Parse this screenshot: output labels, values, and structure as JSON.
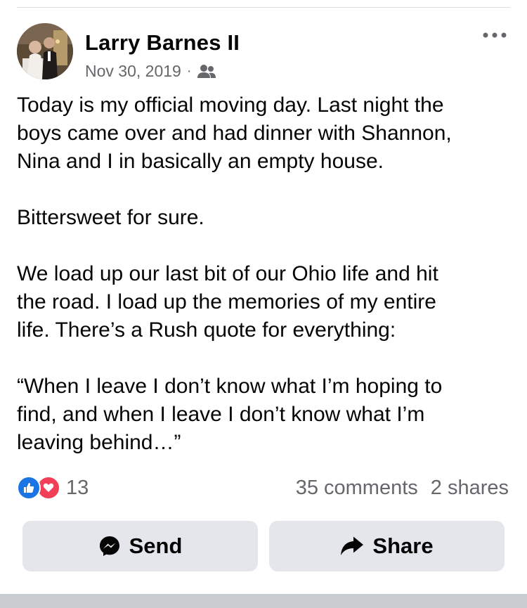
{
  "post": {
    "author": "Larry Barnes II",
    "date": "Nov 30, 2019",
    "separator": "·",
    "audience_icon": "friends-icon",
    "text": {
      "p1_l1": "Today is my official moving day. Last night the",
      "p1_l2": "boys came over and had dinner with Shannon,",
      "p1_l3": "Nina and I in basically an empty house.",
      "p2": "Bittersweet for sure.",
      "p3_l1": "We load up our last bit of our Ohio life and hit",
      "p3_l2": "the road. I load up the memories of my entire",
      "p3_l3": "life. There’s a Rush quote for everything:",
      "p4_l1": "“When I leave I don’t know what I’m hoping to",
      "p4_l2": "find, and when I leave I don’t know what I’m",
      "p4_l3": "leaving behind…”"
    }
  },
  "engagement": {
    "reactions_count": "13",
    "comments": "35 comments",
    "shares": "2 shares"
  },
  "actions": {
    "send_label": "Send",
    "share_label": "Share"
  },
  "colors": {
    "like": "#1b74e4",
    "love": "#f33e58",
    "secondary_text": "#65676b",
    "button_bg": "#e4e6eb"
  }
}
